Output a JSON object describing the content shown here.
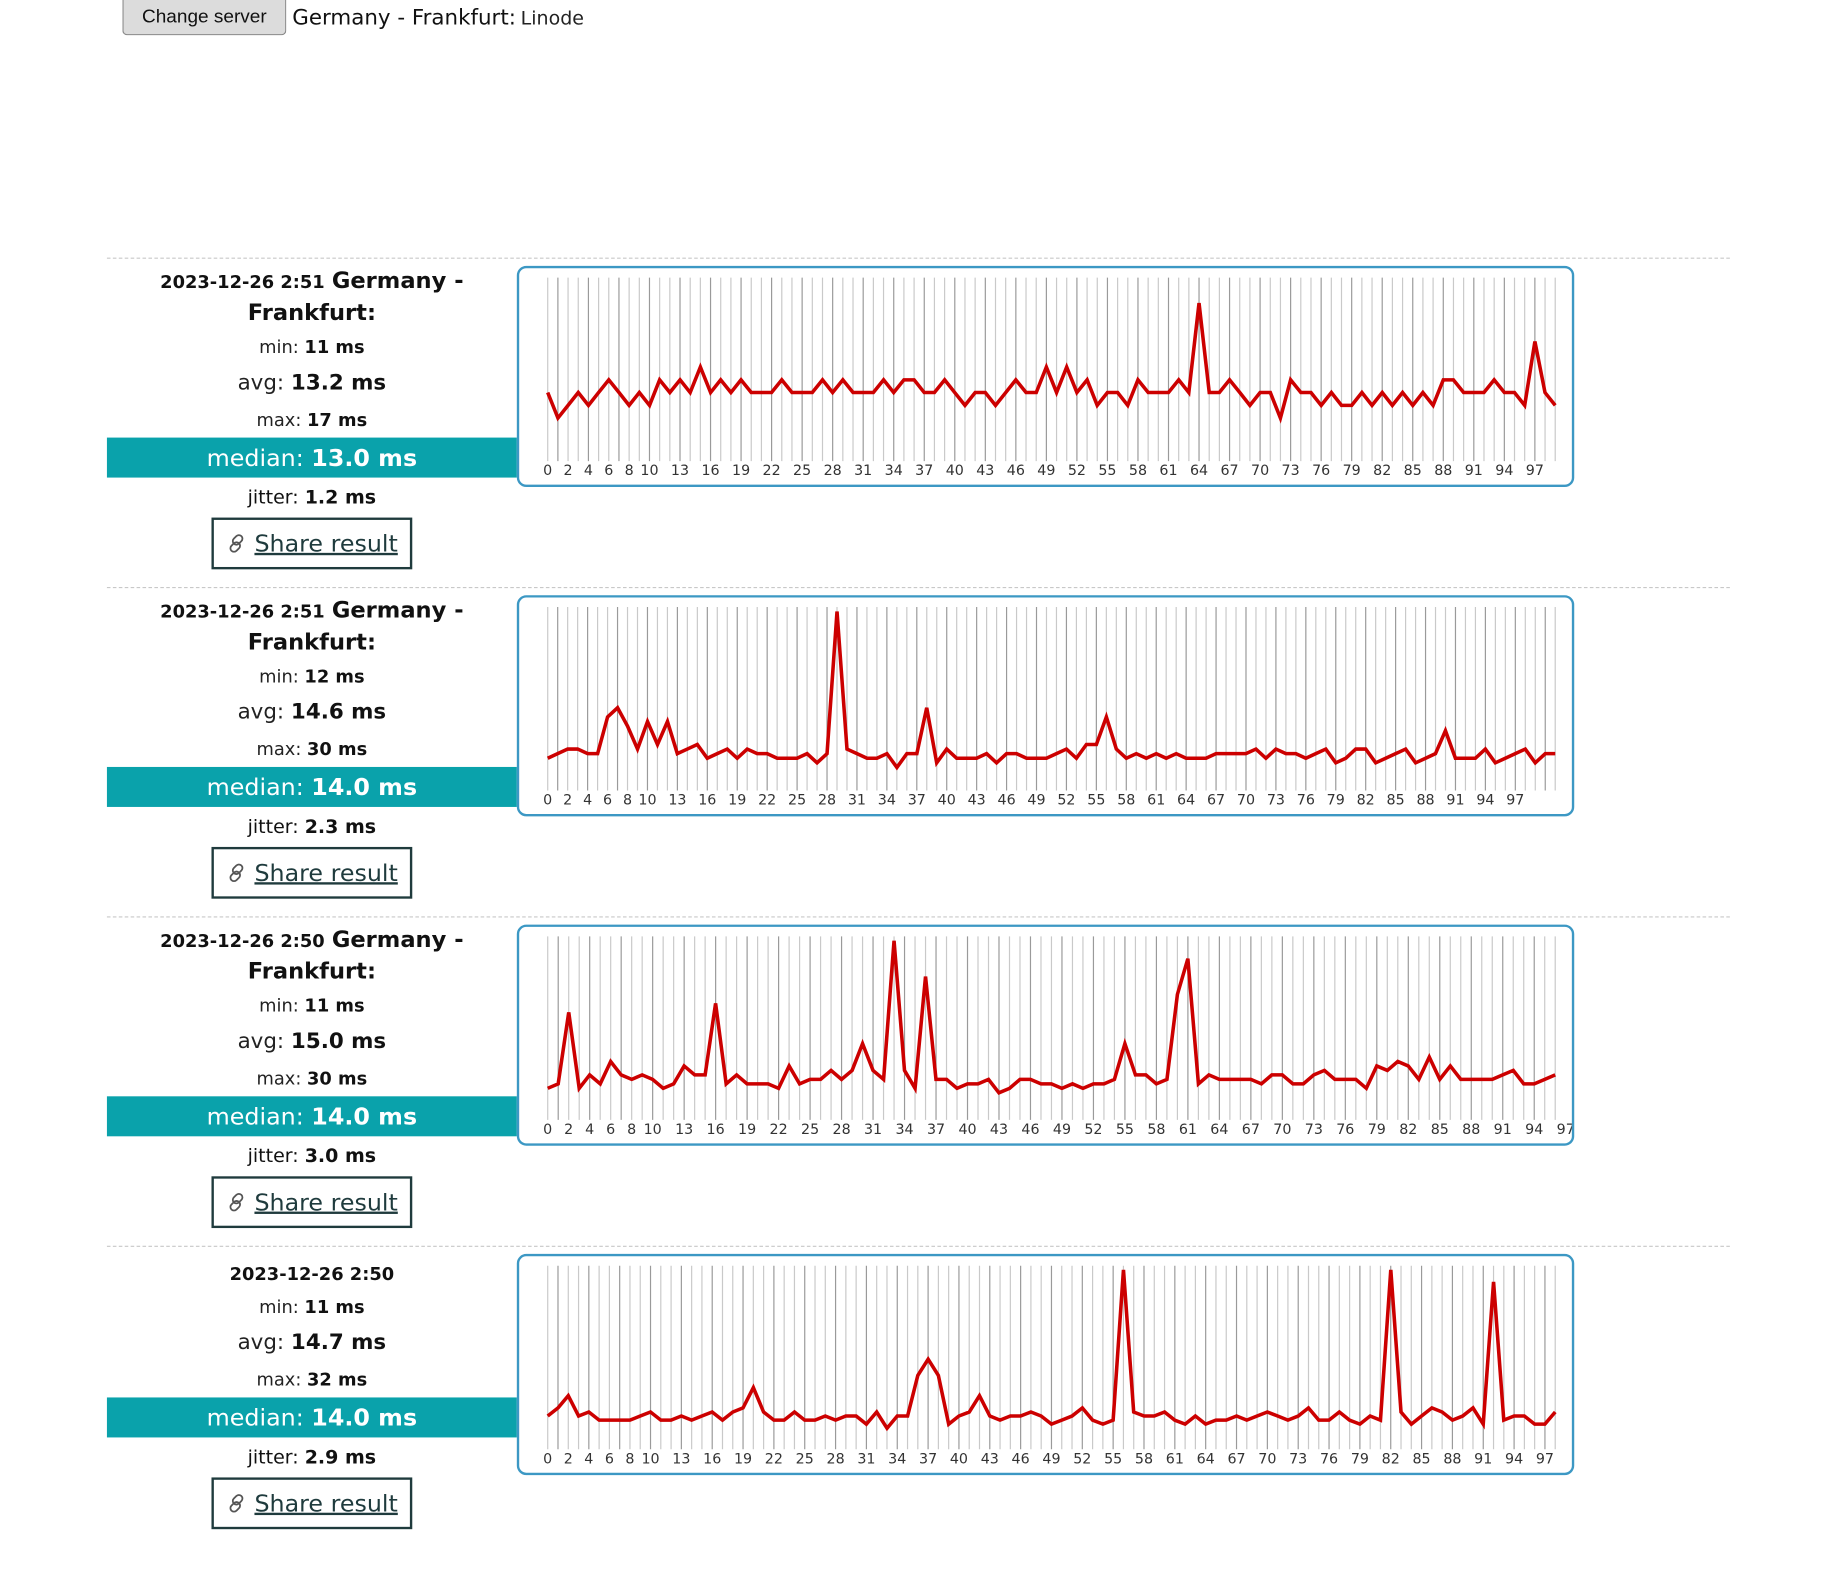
{
  "header": {
    "change_server_label": "Change server",
    "server_name": "Germany - Frankfurt:",
    "server_provider": "Linode"
  },
  "colors": {
    "median_bg": "#0aa2ab",
    "line": "#cc0000",
    "chart_border": "#3c98c4"
  },
  "results": [
    {
      "timestamp": "2023-12-26 2:51",
      "server": "Germany - Frankfurt:",
      "min_label": "min:",
      "min": "11 ms",
      "avg_label": "avg:",
      "avg": "13.2 ms",
      "max_label": "max:",
      "max": "17 ms",
      "median_label": "median:",
      "median": "13.0 ms",
      "jitter_label": "jitter:",
      "jitter": "1.2 ms",
      "share_label": "Share result"
    },
    {
      "timestamp": "2023-12-26 2:51",
      "server": "Germany - Frankfurt:",
      "min_label": "min:",
      "min": "12 ms",
      "avg_label": "avg:",
      "avg": "14.6 ms",
      "max_label": "max:",
      "max": "30 ms",
      "median_label": "median:",
      "median": "14.0 ms",
      "jitter_label": "jitter:",
      "jitter": "2.3 ms",
      "share_label": "Share result"
    },
    {
      "timestamp": "2023-12-26 2:50",
      "server": "Germany - Frankfurt:",
      "min_label": "min:",
      "min": "11 ms",
      "avg_label": "avg:",
      "avg": "15.0 ms",
      "max_label": "max:",
      "max": "30 ms",
      "median_label": "median:",
      "median": "14.0 ms",
      "jitter_label": "jitter:",
      "jitter": "3.0 ms",
      "share_label": "Share result"
    },
    {
      "timestamp": "2023-12-26 2:50",
      "server": "",
      "min_label": "min:",
      "min": "11 ms",
      "avg_label": "avg:",
      "avg": "14.7 ms",
      "max_label": "max:",
      "max": "32 ms",
      "median_label": "median:",
      "median": "14.0 ms",
      "jitter_label": "jitter:",
      "jitter": "2.9 ms",
      "share_label": "Share result"
    }
  ],
  "chart_data": [
    {
      "type": "line",
      "x_tick_labels": [
        "0",
        "2",
        "4",
        "6",
        "8",
        "10",
        "13",
        "16",
        "19",
        "22",
        "25",
        "28",
        "31",
        "34",
        "37",
        "40",
        "43",
        "46",
        "49",
        "52",
        "55",
        "58",
        "61",
        "64",
        "67",
        "70",
        "73",
        "76",
        "79",
        "82",
        "85",
        "88",
        "91",
        "94",
        "97"
      ],
      "x": [
        0,
        99
      ],
      "ylim": [
        10.5,
        17.5
      ],
      "grid_vertical": true,
      "series": [
        {
          "values": [
            13,
            12,
            12.5,
            13,
            12.5,
            13,
            13.5,
            13,
            12.5,
            13,
            12.5,
            13.5,
            13,
            13.5,
            13,
            14,
            13,
            13.5,
            13,
            13.5,
            13,
            13,
            13,
            13.5,
            13,
            13,
            13,
            13.5,
            13,
            13.5,
            13,
            13,
            13,
            13.5,
            13,
            13.5,
            13.5,
            13,
            13,
            13.5,
            13,
            12.5,
            13,
            13,
            12.5,
            13,
            13.5,
            13,
            13,
            14,
            13,
            14,
            13,
            13.5,
            12.5,
            13,
            13,
            12.5,
            13.5,
            13,
            13,
            13,
            13.5,
            13,
            16.5,
            13,
            13,
            13.5,
            13,
            12.5,
            13,
            13,
            12,
            13.5,
            13,
            13,
            12.5,
            13,
            12.5,
            12.5,
            13,
            12.5,
            13,
            12.5,
            13,
            12.5,
            13,
            12.5,
            13.5,
            13.5,
            13,
            13,
            13,
            13.5,
            13,
            13,
            12.5,
            15,
            13,
            12.5
          ]
        }
      ]
    },
    {
      "type": "line",
      "x_tick_labels": [
        "0",
        "2",
        "4",
        "6",
        "8",
        "10",
        "13",
        "16",
        "19",
        "22",
        "25",
        "28",
        "31",
        "34",
        "37",
        "40",
        "43",
        "46",
        "49",
        "52",
        "55",
        "58",
        "61",
        "64",
        "67",
        "70",
        "73",
        "76",
        "79",
        "82",
        "85",
        "88",
        "91",
        "94",
        "97"
      ],
      "x": [
        0,
        99
      ],
      "ylim": [
        11,
        30.5
      ],
      "grid_vertical": true,
      "series": [
        {
          "values": [
            14,
            14.5,
            15,
            15,
            14.5,
            14.5,
            18.5,
            19.5,
            17.5,
            15,
            18,
            15.5,
            18,
            14.5,
            15,
            15.5,
            14,
            14.5,
            15,
            14,
            15,
            14.5,
            14.5,
            14,
            14,
            14,
            14.5,
            13.5,
            14.5,
            30,
            15,
            14.5,
            14,
            14,
            14.5,
            13,
            14.5,
            14.5,
            19.5,
            13.5,
            15,
            14,
            14,
            14,
            14.5,
            13.5,
            14.5,
            14.5,
            14,
            14,
            14,
            14.5,
            15,
            14,
            15.5,
            15.5,
            18.5,
            15,
            14,
            14.5,
            14,
            14.5,
            14,
            14.5,
            14,
            14,
            14,
            14.5,
            14.5,
            14.5,
            14.5,
            15,
            14,
            15,
            14.5,
            14.5,
            14,
            14.5,
            15,
            13.5,
            14,
            15,
            15,
            13.5,
            14,
            14.5,
            15,
            13.5,
            14,
            14.5,
            17,
            14,
            14,
            14,
            15,
            13.5,
            14,
            14.5,
            15,
            13.5,
            14.5,
            14.5
          ]
        }
      ]
    },
    {
      "type": "line",
      "x_tick_labels": [
        "0",
        "2",
        "4",
        "6",
        "8",
        "10",
        "13",
        "16",
        "19",
        "22",
        "25",
        "28",
        "31",
        "34",
        "37",
        "40",
        "43",
        "46",
        "49",
        "52",
        "55",
        "58",
        "61",
        "64",
        "67",
        "70",
        "73",
        "76",
        "79",
        "82",
        "85",
        "88",
        "91",
        "94",
        "97"
      ],
      "x": [
        0,
        99
      ],
      "ylim": [
        10.5,
        30.5
      ],
      "grid_vertical": true,
      "series": [
        {
          "values": [
            13.5,
            14,
            22,
            13.5,
            15,
            14,
            16.5,
            15,
            14.5,
            15,
            14.5,
            13.5,
            14,
            16,
            15,
            15,
            23,
            14,
            15,
            14,
            14,
            14,
            13.5,
            16,
            14,
            14.5,
            14.5,
            15.5,
            14.5,
            15.5,
            18.5,
            15.5,
            14.5,
            30,
            15.5,
            13.5,
            26,
            14.5,
            14.5,
            13.5,
            14,
            14,
            14.5,
            13,
            13.5,
            14.5,
            14.5,
            14,
            14,
            13.5,
            14,
            13.5,
            14,
            14,
            14.5,
            18.5,
            15,
            15,
            14,
            14.5,
            24,
            28,
            14,
            15,
            14.5,
            14.5,
            14.5,
            14.5,
            14,
            15,
            15,
            14,
            14,
            15,
            15.5,
            14.5,
            14.5,
            14.5,
            13.5,
            16,
            15.5,
            16.5,
            16,
            14.5,
            17,
            14.5,
            16,
            14.5,
            14.5,
            14.5,
            14.5,
            15,
            15.5,
            14,
            14,
            14.5,
            15
          ]
        }
      ]
    },
    {
      "type": "line",
      "x_tick_labels": [
        "0",
        "2",
        "4",
        "6",
        "8",
        "10",
        "13",
        "16",
        "19",
        "22",
        "25",
        "28",
        "31",
        "34",
        "37",
        "40",
        "43",
        "46",
        "49",
        "52",
        "55",
        "58",
        "61",
        "64",
        "67",
        "70",
        "73",
        "76",
        "79",
        "82",
        "85",
        "88",
        "91",
        "94",
        "97"
      ],
      "x": [
        0,
        99
      ],
      "ylim": [
        10.5,
        32.5
      ],
      "grid_vertical": true,
      "series": [
        {
          "values": [
            14,
            15,
            16.5,
            14,
            14.5,
            13.5,
            13.5,
            13.5,
            13.5,
            14,
            14.5,
            13.5,
            13.5,
            14,
            13.5,
            14,
            14.5,
            13.5,
            14.5,
            15,
            17.5,
            14.5,
            13.5,
            13.5,
            14.5,
            13.5,
            13.5,
            14,
            13.5,
            14,
            14,
            13,
            14.5,
            12.5,
            14,
            14,
            19,
            21,
            19,
            13,
            14,
            14.5,
            16.5,
            14,
            13.5,
            14,
            14,
            14.5,
            14,
            13,
            13.5,
            14,
            15,
            13.5,
            13,
            13.5,
            32,
            14.5,
            14,
            14,
            14.5,
            13.5,
            13,
            14,
            13,
            13.5,
            13.5,
            14,
            13.5,
            14,
            14.5,
            14,
            13.5,
            14,
            15,
            13.5,
            13.5,
            14.5,
            13.5,
            13,
            14,
            13.5,
            32,
            14.5,
            13,
            14,
            15,
            14.5,
            13.5,
            14,
            15,
            13,
            30.5,
            13.5,
            14,
            14,
            13,
            13,
            14.5
          ]
        }
      ]
    }
  ]
}
